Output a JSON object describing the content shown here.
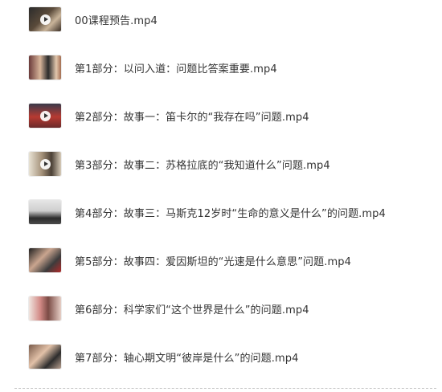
{
  "files": [
    {
      "name": "00课程预告.mp4",
      "thumb_icon": "video-thumbnail"
    },
    {
      "name": "第1部分：以问入道：问题比答案重要.mp4",
      "thumb_icon": "video-thumbnail"
    },
    {
      "name": "第2部分：故事一：笛卡尔的“我存在吗”问题.mp4",
      "thumb_icon": "video-thumbnail"
    },
    {
      "name": "第3部分：故事二：苏格拉底的“我知道什么”问题.mp4",
      "thumb_icon": "video-thumbnail"
    },
    {
      "name": "第4部分：故事三：马斯克12岁时“生命的意义是什么”的问题.mp4",
      "thumb_icon": "video-thumbnail"
    },
    {
      "name": "第5部分：故事四：爱因斯坦的“光速是什么意思”问题.mp4",
      "thumb_icon": "video-thumbnail"
    },
    {
      "name": "第6部分：科学家们“这个世界是什么”的问题.mp4",
      "thumb_icon": "video-thumbnail"
    },
    {
      "name": "第7部分：轴心期文明“彼岸是什么”的问题.mp4",
      "thumb_icon": "video-thumbnail"
    }
  ],
  "colors": {
    "text": "#333333",
    "divider": "#c8c8c8",
    "background": "#ffffff"
  }
}
